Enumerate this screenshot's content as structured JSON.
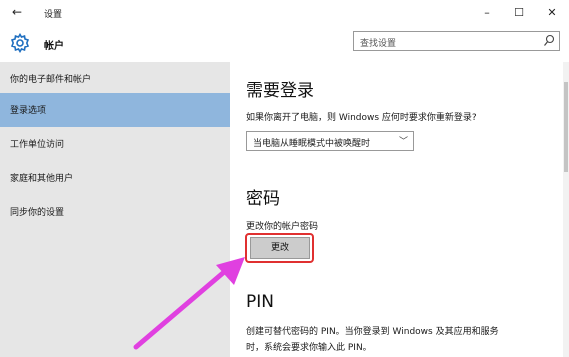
{
  "window": {
    "title": "设置",
    "back_icon": "←",
    "minimize": "–",
    "maximize": "☐",
    "close": "✕"
  },
  "header": {
    "section_name": "帐户",
    "search_placeholder": "查找设置"
  },
  "sidebar": {
    "items": [
      {
        "label": "你的电子邮件和帐户",
        "active": false
      },
      {
        "label": "登录选项",
        "active": true
      },
      {
        "label": "工作单位访问",
        "active": false
      },
      {
        "label": "家庭和其他用户",
        "active": false
      },
      {
        "label": "同步你的设置",
        "active": false
      }
    ]
  },
  "main": {
    "require_signin": {
      "heading": "需要登录",
      "question": "如果你离开了电脑，则 Windows 应何时要求你重新登录?",
      "dropdown_value": "当电脑从睡眠模式中被唤醒时"
    },
    "password": {
      "heading": "密码",
      "description": "更改你的帐户密码",
      "button_label": "更改"
    },
    "pin": {
      "heading": "PIN",
      "description_line1": "创建可替代密码的 PIN。当你登录到 Windows 及其应用和服务",
      "description_line2": "时，系统会要求你输入此 PIN。"
    }
  },
  "colors": {
    "sidebar_bg": "#e6e6e6",
    "active_item": "#8fb6dd",
    "highlight_border": "#e03030",
    "annotation_arrow": "#e040e0"
  }
}
